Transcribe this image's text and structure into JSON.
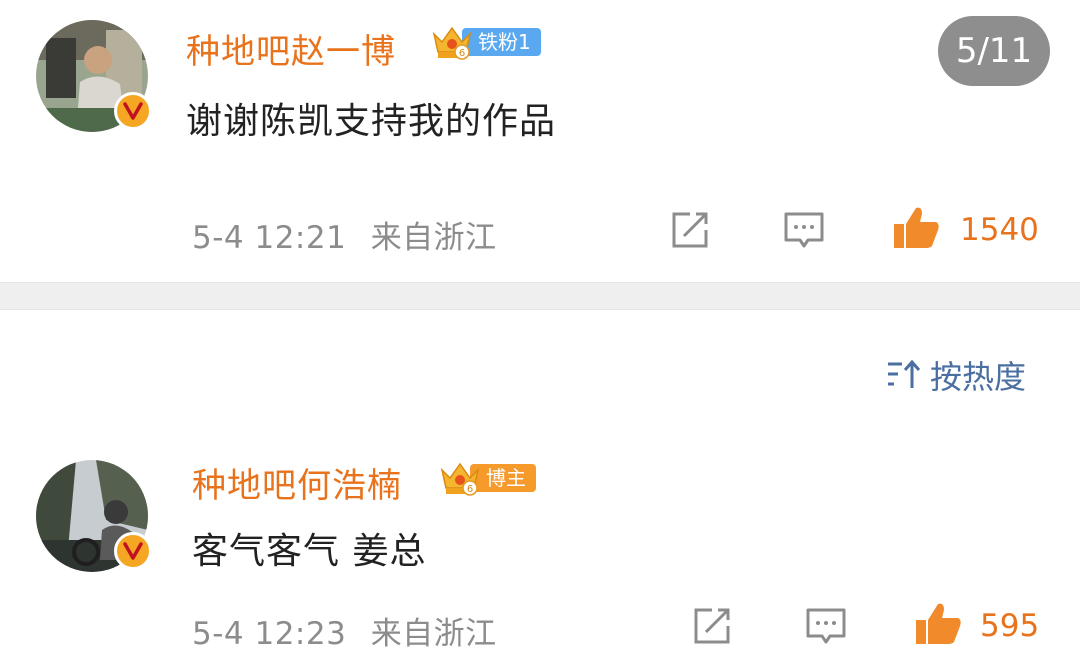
{
  "pager": {
    "label": "5/11"
  },
  "sort": {
    "label": "按热度"
  },
  "comments": [
    {
      "username": "种地吧赵一博",
      "badge_level": "6",
      "badge_label": "铁粉1",
      "text": "谢谢陈凯支持我的作品",
      "time": "5-4 12:21",
      "location": "来自浙江",
      "likes": "1540"
    },
    {
      "username": "种地吧何浩楠",
      "badge_level": "6",
      "badge_label": "博主",
      "text": "客气客气 姜总",
      "time": "5-4 12:23",
      "location": "来自浙江",
      "likes": "595"
    }
  ],
  "colors": {
    "username": "#e8731c",
    "like": "#f08a2b",
    "meta": "#8c8c8c",
    "sort": "#4a6fa0",
    "pager_bg": "#8e8e8e"
  },
  "icons": [
    "verified-v-icon",
    "crown-icon",
    "share-icon",
    "comment-icon",
    "thumbs-up-icon",
    "sort-icon"
  ]
}
